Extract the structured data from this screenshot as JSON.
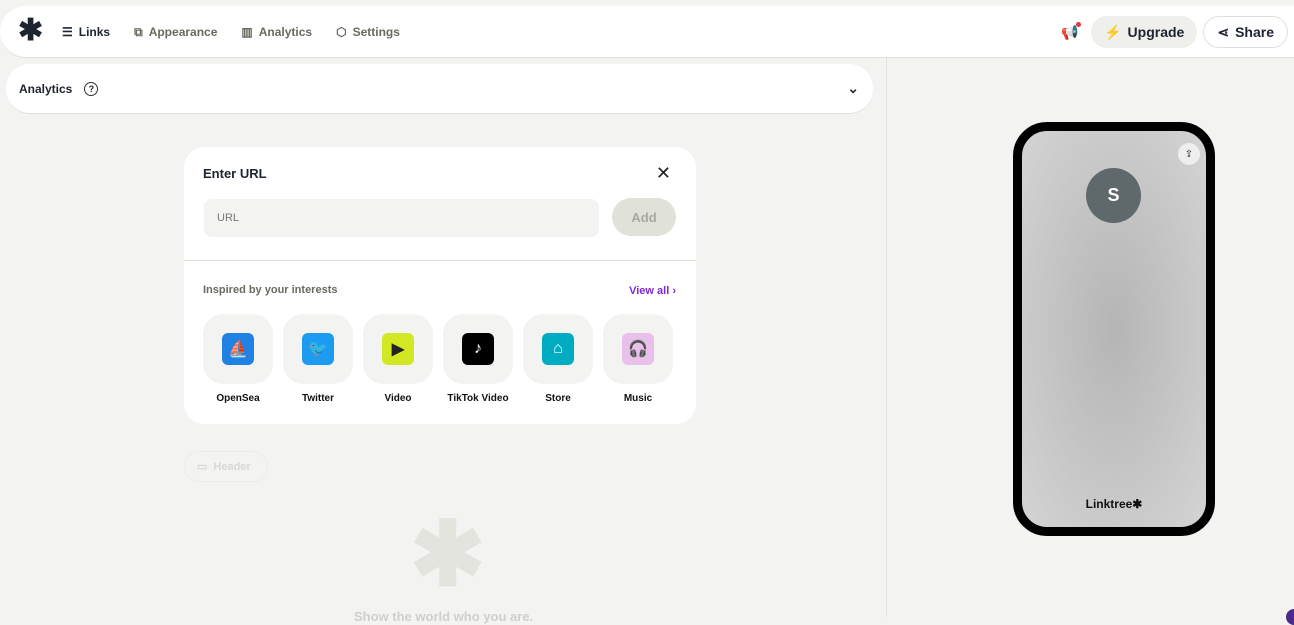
{
  "nav": {
    "links": "Links",
    "appearance": "Appearance",
    "analytics": "Analytics",
    "settings": "Settings"
  },
  "actions": {
    "upgrade": "Upgrade",
    "share": "Share"
  },
  "analytics_bar": {
    "title": "Analytics",
    "help": "?"
  },
  "modal": {
    "title": "Enter URL",
    "url_placeholder": "URL",
    "add": "Add",
    "inspired": "Inspired by your interests",
    "view_all": "View all",
    "tiles": [
      {
        "label": "OpenSea",
        "color": "#2081e2",
        "glyph": "⛵"
      },
      {
        "label": "Twitter",
        "color": "#1d9bf0",
        "glyph": "🐦"
      },
      {
        "label": "Video",
        "color": "#d2e823",
        "glyph": "▶"
      },
      {
        "label": "TikTok Video",
        "color": "#000000",
        "glyph": "♪"
      },
      {
        "label": "Store",
        "color": "#00acc1",
        "glyph": "⌂"
      },
      {
        "label": "Music",
        "color": "#e8c0e9",
        "glyph": "🎧"
      }
    ]
  },
  "header_button": "Header",
  "empty_text": "Show the world who you are.",
  "preview": {
    "avatar_letter": "S",
    "brand": "Linktree✱"
  }
}
